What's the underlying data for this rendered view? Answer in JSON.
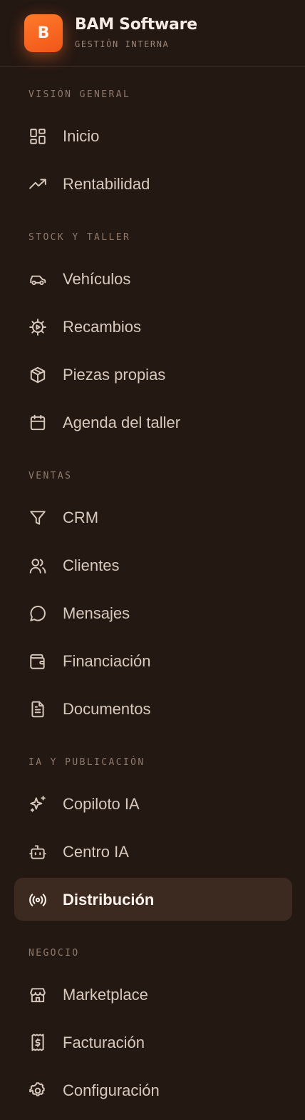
{
  "brand": {
    "logo_letter": "B",
    "name": "BAM Software",
    "subtitle": "GESTIÓN INTERNA",
    "accent_color": "#F26522"
  },
  "sections": [
    {
      "label": "VISIÓN GENERAL",
      "items": [
        {
          "label": "Inicio",
          "icon": "dashboard-grid-icon"
        },
        {
          "label": "Rentabilidad",
          "icon": "trending-up-icon"
        }
      ]
    },
    {
      "label": "STOCK Y TALLER",
      "items": [
        {
          "label": "Vehículos",
          "icon": "car-icon"
        },
        {
          "label": "Recambios",
          "icon": "gear-cog-icon"
        },
        {
          "label": "Piezas propias",
          "icon": "package-box-icon"
        },
        {
          "label": "Agenda del taller",
          "icon": "calendar-icon"
        }
      ]
    },
    {
      "label": "VENTAS",
      "items": [
        {
          "label": "CRM",
          "icon": "funnel-filter-icon"
        },
        {
          "label": "Clientes",
          "icon": "users-icon"
        },
        {
          "label": "Mensajes",
          "icon": "chat-bubble-icon"
        },
        {
          "label": "Financiación",
          "icon": "wallet-icon"
        },
        {
          "label": "Documentos",
          "icon": "document-icon"
        }
      ]
    },
    {
      "label": "IA Y PUBLICACIÓN",
      "items": [
        {
          "label": "Copiloto IA",
          "icon": "sparkles-icon"
        },
        {
          "label": "Centro IA",
          "icon": "bot-icon"
        },
        {
          "label": "Distribución",
          "icon": "broadcast-radio-icon",
          "active": true
        }
      ]
    },
    {
      "label": "NEGOCIO",
      "items": [
        {
          "label": "Marketplace",
          "icon": "storefront-icon"
        },
        {
          "label": "Facturación",
          "icon": "receipt-dollar-icon"
        },
        {
          "label": "Configuración",
          "icon": "settings-cog-icon"
        }
      ]
    }
  ]
}
